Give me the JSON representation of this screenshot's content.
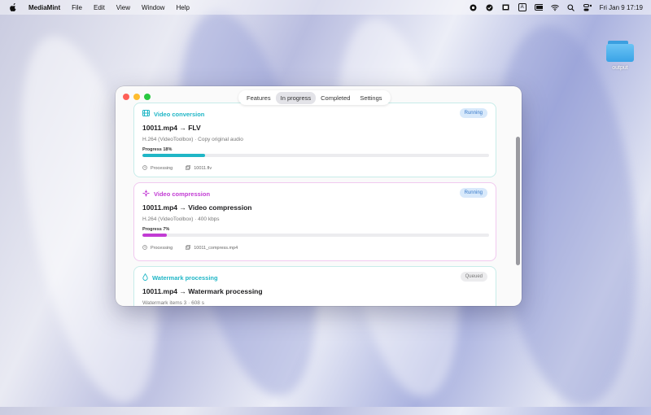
{
  "menubar": {
    "apple_icon": "apple-icon",
    "app_name": "MediaMint",
    "menus": [
      "File",
      "Edit",
      "View",
      "Window",
      "Help"
    ],
    "status_box_label": "A",
    "clock": "Fri Jan 9  17:19"
  },
  "desktop": {
    "folder_label": "output"
  },
  "window": {
    "tabs": [
      "Features",
      "In progress",
      "Completed",
      "Settings"
    ],
    "active_tab": "In progress",
    "cards": [
      {
        "category": "Video conversion",
        "category_icon": "film-icon",
        "accent": "#1fb6c6",
        "status": "Running",
        "title": "10011.mp4 → FLV",
        "subtitle": "H.264 (VideoToolbox) · Copy original audio",
        "progress_label": "Progress 18%",
        "progress": 0.18,
        "state": "Processing",
        "output_file": "10011.flv"
      },
      {
        "category": "Video compression",
        "category_icon": "compress-arrows-icon",
        "accent": "#c23bd4",
        "status": "Running",
        "title": "10011.mp4 → Video compression",
        "subtitle": "H.264 (VideoToolbox) · 400 kbps",
        "progress_label": "Progress 7%",
        "progress": 0.07,
        "state": "Processing",
        "output_file": "10011_compress.mp4"
      },
      {
        "category": "Watermark processing",
        "category_icon": "droplet-icon",
        "accent": "#1fb6c6",
        "status": "Queued",
        "title": "10011.mp4 → Watermark processing",
        "subtitle": "Watermark items 3 · 608 s"
      }
    ]
  }
}
